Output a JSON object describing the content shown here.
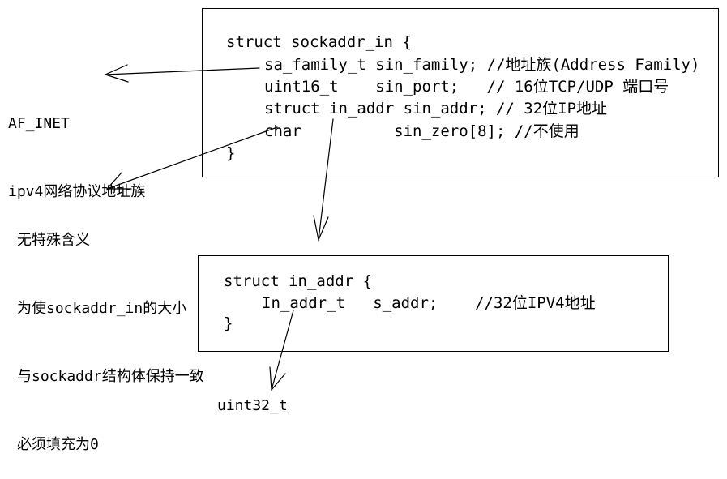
{
  "sockaddr_in": {
    "header": "struct sockaddr_in {",
    "fields": [
      "sa_family_t sin_family; //地址族(Address Family)",
      "uint16_t    sin_port;   // 16位TCP/UDP 端口号",
      "struct in_addr sin_addr; // 32位IP地址",
      "char          sin_zero[8]; //不使用"
    ],
    "close": "}"
  },
  "in_addr": {
    "header": "struct in_addr {",
    "fields": [
      "In_addr_t   s_addr;    //32位IPV4地址"
    ],
    "close": "}"
  },
  "notes": {
    "af_inet": [
      "AF_INET",
      "ipv4网络协议地址族"
    ],
    "sin_zero": [
      "无特殊含义",
      "为使sockaddr_in的大小",
      "与sockaddr结构体保持一致",
      "必须填充为0"
    ],
    "uint32": "uint32_t"
  }
}
